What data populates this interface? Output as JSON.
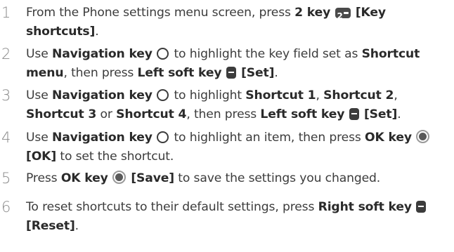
{
  "steps": [
    {
      "number": "1",
      "parts": {
        "t1": "From the Phone settings menu screen, press ",
        "b1": "2 key",
        "icon1": "2",
        "b2": "[Key shortcuts]",
        "t2": "."
      }
    },
    {
      "number": "2",
      "parts": {
        "t1": "Use ",
        "b1": "Navigation key",
        "t2": " to highlight the key field set as ",
        "b2": "Shortcut menu",
        "t3": ", then press ",
        "b3": "Left soft key",
        "b4": "[Set]",
        "t4": "."
      }
    },
    {
      "number": "3",
      "parts": {
        "t1": "Use ",
        "b1": "Navigation key",
        "t2": " to highlight ",
        "b2": "Shortcut 1",
        "t3": ", ",
        "b3": "Shortcut 2",
        "t4": ", ",
        "b4": "Shortcut 3",
        "t5": " or ",
        "b5": "Shortcut 4",
        "t6": ", then press ",
        "b6": "Left soft key",
        "b7": "[Set]",
        "t7": "."
      }
    },
    {
      "number": "4",
      "parts": {
        "t1": "Use ",
        "b1": "Navigation key",
        "t2": " to highlight an item, then press ",
        "b2": "OK key",
        "b3": "[OK]",
        "t3": " to set the shortcut."
      }
    },
    {
      "number": "5",
      "parts": {
        "t1": "Press ",
        "b1": "OK key",
        "b2": "[Save]",
        "t2": " to save the settings you changed."
      }
    },
    {
      "number": "6",
      "parts": {
        "t1": "To reset shortcuts to their default settings, press ",
        "b1": "Right soft key",
        "b2": "[Reset]",
        "t2": "."
      }
    }
  ],
  "icons": {
    "key_2": "two-key-icon",
    "navigation_key": "navigation-key-icon",
    "soft_key": "soft-key-icon",
    "ok_key": "ok-key-icon"
  },
  "colors": {
    "text": "#3c3c3c",
    "bold_text": "#2a2a2a",
    "step_number": "#8a8a8a"
  }
}
